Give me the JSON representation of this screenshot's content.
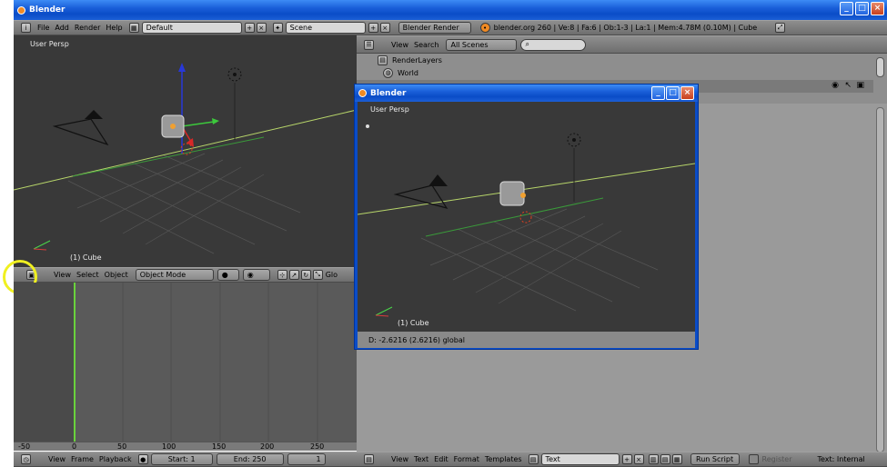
{
  "window": {
    "title": "Blender",
    "menu": [
      "File",
      "Add",
      "Render",
      "Help"
    ],
    "layout_value": "Default",
    "scene_value": "Scene",
    "engine_value": "Blender Render",
    "stats": "blender.org 260 | Ve:8 | Fa:6 | Ob:1-3 | La:1 | Mem:4.78M (0.10M) | Cube"
  },
  "viewport_main": {
    "label": "User Persp",
    "object_label": "(1) Cube",
    "menu": [
      "View",
      "Select",
      "Object"
    ],
    "mode_value": "Object Mode",
    "overflow_label": "Glo"
  },
  "outliner": {
    "menu": [
      "View",
      "Search"
    ],
    "filter_value": "All Scenes",
    "rows": [
      "RenderLayers",
      "World"
    ]
  },
  "dialog": {
    "title": "Blender",
    "viewport_label": "User Persp",
    "object_label": "(1) Cube",
    "status": "D: -2.6216 (2.6216) global"
  },
  "timeline": {
    "ruler": [
      "-50",
      "0",
      "50",
      "100",
      "150",
      "200",
      "250"
    ],
    "menu": [
      "View",
      "Frame",
      "Playback"
    ],
    "start": "Start: 1",
    "end": "End: 250",
    "current": "1"
  },
  "text_editor": {
    "menu": [
      "View",
      "Text",
      "Edit",
      "Format",
      "Templates"
    ],
    "text_value": "Text",
    "run_script": "Run Script",
    "register": "Register",
    "internal": "Text: Internal"
  },
  "colors": {
    "highlight": "#f0f020",
    "xp_blue": "#0a4cc7",
    "playhead": "#6ad23c"
  }
}
